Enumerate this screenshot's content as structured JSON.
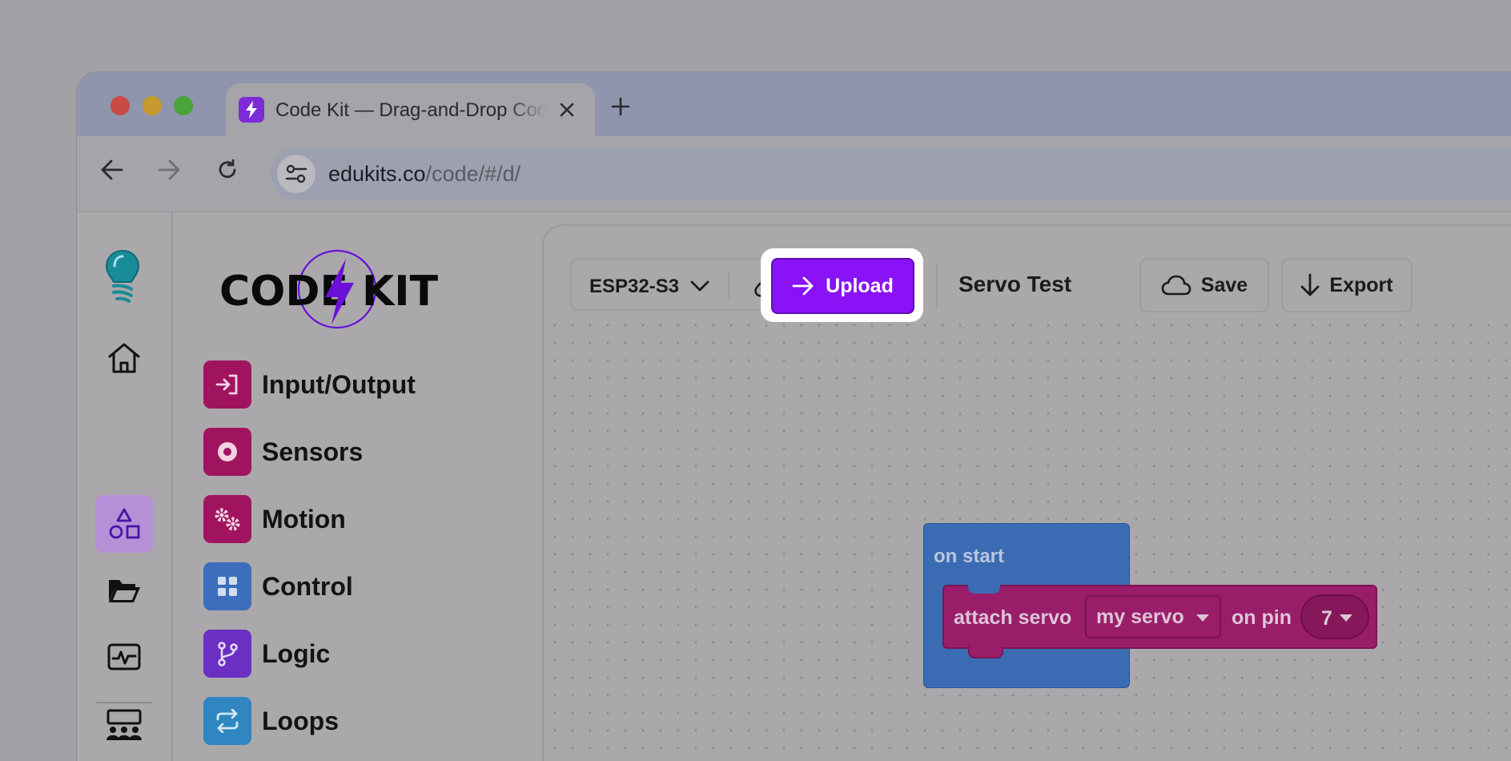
{
  "browser": {
    "tab": {
      "title": "Code Kit — Drag-and-Drop Coding",
      "favicon": "lightning-bolt-icon"
    },
    "new_tab_label": "+",
    "url_host": "edukits.co",
    "url_path": "/code/#/d/"
  },
  "rail": {
    "items": [
      {
        "name": "home",
        "icon": "home-icon"
      },
      {
        "name": "blocks",
        "icon": "shapes-icon",
        "active": true
      },
      {
        "name": "files",
        "icon": "folder-open-icon"
      },
      {
        "name": "monitor",
        "icon": "pulse-icon"
      },
      {
        "name": "classroom",
        "icon": "classroom-icon"
      }
    ]
  },
  "brand": {
    "left": "CODE",
    "right": "KIT"
  },
  "categories": [
    {
      "label": "Input/Output",
      "color": "#a0145f",
      "icon": "sign-in-icon"
    },
    {
      "label": "Sensors",
      "color": "#a0145f",
      "icon": "record-icon"
    },
    {
      "label": "Motion",
      "color": "#a0145f",
      "icon": "gears-icon"
    },
    {
      "label": "Control",
      "color": "#3d6ebc",
      "icon": "grid-icon"
    },
    {
      "label": "Logic",
      "color": "#6b2fc4",
      "icon": "branch-icon"
    },
    {
      "label": "Loops",
      "color": "#2f86c0",
      "icon": "repeat-icon"
    }
  ],
  "toolbar": {
    "board": "ESP32-S3",
    "upload_label": "Upload",
    "project_name": "Servo Test",
    "save_label": "Save",
    "export_label": "Export"
  },
  "blocks": {
    "start_label": "on start",
    "attach_label": "attach servo",
    "servo_var": "my servo",
    "on_pin_label": "on pin",
    "pin_value": "7"
  },
  "colors": {
    "upload": "#8a12f7",
    "event_block": "#3b6bb2",
    "motion_block": "#9a1d6a"
  }
}
